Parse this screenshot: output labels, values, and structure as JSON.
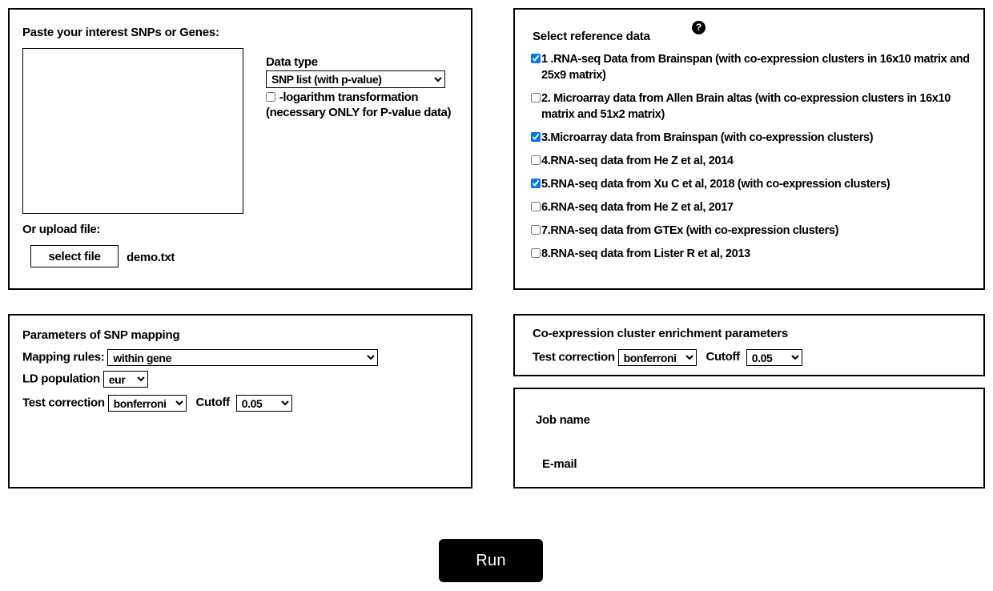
{
  "input_panel": {
    "title": "Paste your interest SNPs or Genes:",
    "textarea_value": "",
    "textarea_placeholder": "",
    "data_type_label": "Data type",
    "data_type_value": "SNP list (with p-value)",
    "data_type_options": [
      "SNP list (with p-value)"
    ],
    "log_transform_label": "-logarithm transformation (necessary ONLY for P-value data)",
    "log_transform_checked": false,
    "upload_label": "Or upload file:",
    "select_file_button": "select file",
    "selected_file_name": "demo.txt"
  },
  "reference_panel": {
    "title": "Select reference data",
    "help_icon": "question-mark-icon",
    "help_glyph": "?",
    "items": [
      {
        "label": "1 .RNA-seq Data from Brainspan (with co-expression clusters in 16x10 matrix and 25x9 matrix)",
        "checked": true
      },
      {
        "label": "2. Microarray data from Allen Brain altas (with co-expression clusters in 16x10 matrix and 51x2 matrix)",
        "checked": false
      },
      {
        "label": "3.Microarray data from Brainspan (with co-expression clusters)",
        "checked": true
      },
      {
        "label": "4.RNA-seq data from He Z et al, 2014",
        "checked": false
      },
      {
        "label": "5.RNA-seq data from Xu C et al, 2018 (with co-expression clusters)",
        "checked": true
      },
      {
        "label": "6.RNA-seq data from He Z et al, 2017",
        "checked": false
      },
      {
        "label": "7.RNA-seq data from GTEx (with co-expression clusters)",
        "checked": false
      },
      {
        "label": "8.RNA-seq data from Lister R et al, 2013",
        "checked": false
      }
    ]
  },
  "mapping_panel": {
    "title": "Parameters of SNP mapping",
    "mapping_rules_label": "Mapping rules:",
    "mapping_rules_value": "within gene",
    "mapping_rules_options": [
      "within gene"
    ],
    "ld_population_label": "LD population",
    "ld_population_value": "eur",
    "ld_population_options": [
      "eur"
    ],
    "test_correction_label": "Test correction",
    "test_correction_value": "bonferroni",
    "test_correction_options": [
      "bonferroni"
    ],
    "cutoff_label": "Cutoff",
    "cutoff_value": "0.05",
    "cutoff_options": [
      "0.05"
    ]
  },
  "coexp_panel": {
    "title": "Co-expression cluster enrichment parameters",
    "test_correction_label": "Test correction",
    "test_correction_value": "bonferroni",
    "test_correction_options": [
      "bonferroni"
    ],
    "cutoff_label": "Cutoff",
    "cutoff_value": "0.05",
    "cutoff_options": [
      "0.05"
    ]
  },
  "job_panel": {
    "job_name_label": "Job name",
    "job_name_value": "",
    "email_label": "E-mail",
    "email_value": ""
  },
  "run_button": {
    "label": "Run",
    "background_color": "#000000",
    "text_color": "#ffffff"
  }
}
